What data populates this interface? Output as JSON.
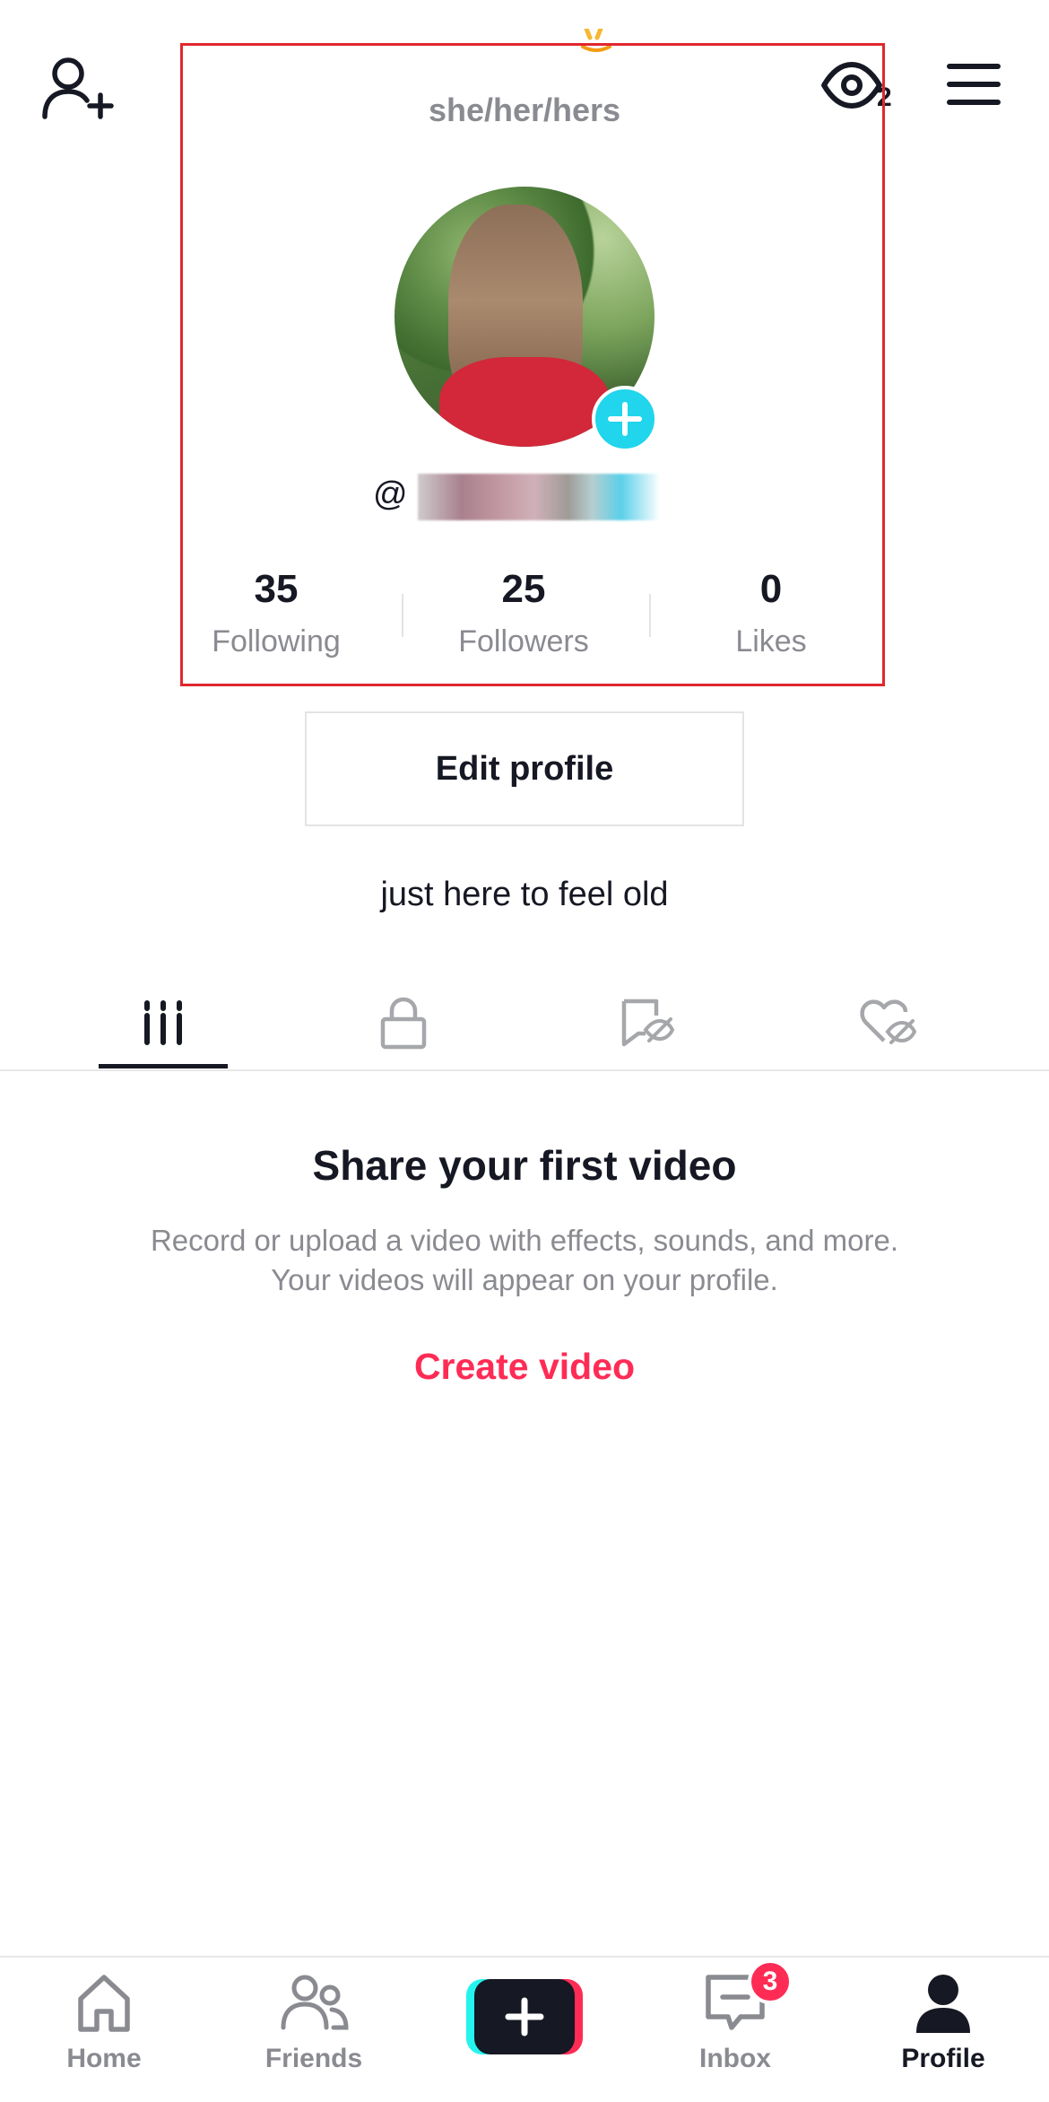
{
  "header": {
    "pronouns": "she/her/hers",
    "profile_views_count": "2"
  },
  "profile": {
    "username_prefix": "@",
    "stats": [
      {
        "value": "35",
        "label": "Following"
      },
      {
        "value": "25",
        "label": "Followers"
      },
      {
        "value": "0",
        "label": "Likes"
      }
    ],
    "edit_profile_label": "Edit profile",
    "bio": "just here to feel old"
  },
  "tabs": [
    {
      "icon": "grid-videos-icon",
      "active": true
    },
    {
      "icon": "lock-icon",
      "active": false
    },
    {
      "icon": "repost-hidden-icon",
      "active": false
    },
    {
      "icon": "liked-hidden-icon",
      "active": false
    }
  ],
  "empty_state": {
    "title": "Share your first video",
    "description_line1": "Record or upload a video with effects, sounds, and more.",
    "description_line2": "Your videos will appear on your profile.",
    "action_label": "Create video"
  },
  "bottom_nav": {
    "items": [
      {
        "label": "Home",
        "icon": "home-icon"
      },
      {
        "label": "Friends",
        "icon": "friends-icon"
      },
      {
        "label": "",
        "icon": "create-plus-icon"
      },
      {
        "label": "Inbox",
        "icon": "inbox-icon",
        "badge": "3"
      },
      {
        "label": "Profile",
        "icon": "profile-icon",
        "active": true
      }
    ]
  },
  "colors": {
    "accent_red": "#fe2c55",
    "accent_cyan": "#25f4ee",
    "avatar_add": "#20d5ec",
    "text_primary": "#161823",
    "text_secondary": "#8a8b91",
    "highlight_box": "#e0282e"
  }
}
